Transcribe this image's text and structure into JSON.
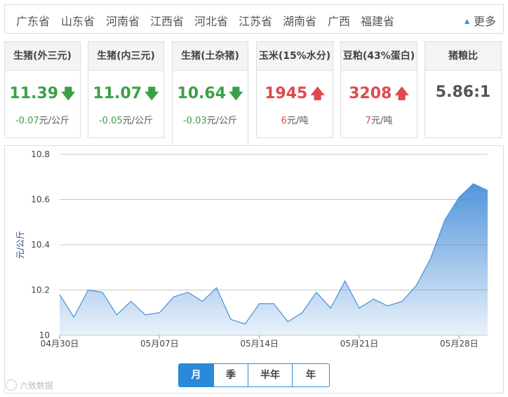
{
  "provinces": {
    "items": [
      "广东省",
      "山东省",
      "河南省",
      "江西省",
      "河北省",
      "江苏省",
      "湖南省",
      "广西",
      "福建省"
    ],
    "more_label": "更多"
  },
  "cards": [
    {
      "title": "生猪(外三元)",
      "price": "11.39",
      "direction": "down",
      "change": "-0.07",
      "unit": "元/公斤"
    },
    {
      "title": "生猪(内三元)",
      "price": "11.07",
      "direction": "down",
      "change": "-0.05",
      "unit": "元/公斤"
    },
    {
      "title": "生猪(土杂猪)",
      "price": "10.64",
      "direction": "down",
      "change": "-0.03",
      "unit": "元/公斤",
      "active": true
    },
    {
      "title": "玉米(15%水分)",
      "price": "1945",
      "direction": "up",
      "change": "6",
      "unit": "元/吨"
    },
    {
      "title": "豆粕(43%蛋白)",
      "price": "3208",
      "direction": "up",
      "change": "7",
      "unit": "元/吨"
    },
    {
      "title": "猪粮比",
      "price": "5.86:1",
      "direction": "none",
      "change": "",
      "unit": ""
    }
  ],
  "colors": {
    "down": "#3aa047",
    "up": "#e0494d",
    "accent": "#2b8ad8",
    "line": "#4a90d9"
  },
  "range_buttons": [
    {
      "label": "月",
      "active": true
    },
    {
      "label": "季",
      "active": false
    },
    {
      "label": "半年",
      "active": false
    },
    {
      "label": "年",
      "active": false
    }
  ],
  "watermark": "六致数据",
  "chart_data": {
    "type": "area",
    "ylabel": "元/公斤",
    "xlabel": "",
    "ylim": [
      10,
      10.8
    ],
    "yticks": [
      "10",
      "10.2",
      "10.4",
      "10.6",
      "10.8"
    ],
    "x": [
      "04-30",
      "05-01",
      "05-02",
      "05-03",
      "05-04",
      "05-05",
      "05-06",
      "05-07",
      "05-08",
      "05-09",
      "05-10",
      "05-11",
      "05-12",
      "05-13",
      "05-14",
      "05-15",
      "05-16",
      "05-17",
      "05-18",
      "05-19",
      "05-20",
      "05-21",
      "05-22",
      "05-23",
      "05-24",
      "05-25",
      "05-26",
      "05-27",
      "05-28",
      "05-29",
      "05-30"
    ],
    "xtick_labels": [
      {
        "index": 0,
        "label": "04月30日"
      },
      {
        "index": 7,
        "label": "05月07日"
      },
      {
        "index": 14,
        "label": "05月14日"
      },
      {
        "index": 21,
        "label": "05月21日"
      },
      {
        "index": 28,
        "label": "05月28日"
      }
    ],
    "values": [
      10.18,
      10.08,
      10.2,
      10.19,
      10.09,
      10.15,
      10.09,
      10.1,
      10.17,
      10.19,
      10.15,
      10.21,
      10.07,
      10.05,
      10.14,
      10.14,
      10.06,
      10.1,
      10.19,
      10.12,
      10.24,
      10.12,
      10.16,
      10.13,
      10.15,
      10.22,
      10.34,
      10.51,
      10.61,
      10.67,
      10.64
    ],
    "grid": true,
    "legend": "none"
  }
}
